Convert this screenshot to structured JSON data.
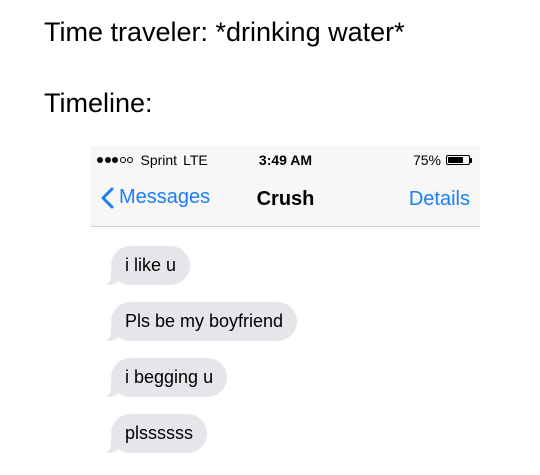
{
  "caption": {
    "line1": "Time traveler: *drinking water*",
    "line2": "Timeline:"
  },
  "phone": {
    "status_bar": {
      "signal_full_bars": 3,
      "signal_total_bars": 5,
      "carrier": "Sprint",
      "network": "LTE",
      "time": "3:49 AM",
      "battery": "75%",
      "battery_level": 0.75
    },
    "nav": {
      "back_label": "Messages",
      "title": "Crush",
      "details_label": "Details",
      "accent_color": "#1a7ef5"
    },
    "messages": [
      {
        "text": "i like u"
      },
      {
        "text": "Pls be my boyfriend"
      },
      {
        "text": "i begging u"
      },
      {
        "text": "plssssss"
      }
    ],
    "bubble_color": "#e5e5ea"
  }
}
